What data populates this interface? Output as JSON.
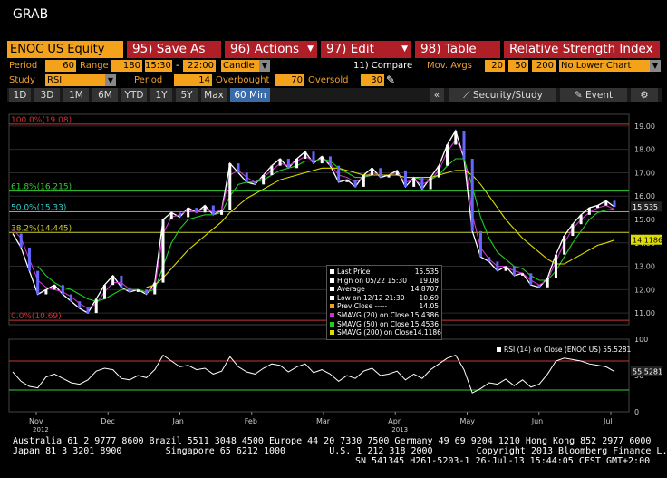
{
  "app_title": "GRAB",
  "ticker": "ENOC US Equity",
  "toolbar": [
    {
      "num": "95)",
      "label": "Save As"
    },
    {
      "num": "96)",
      "label": "Actions"
    },
    {
      "num": "97)",
      "label": "Edit"
    },
    {
      "num": "98)",
      "label": "Table"
    }
  ],
  "study_title": "Relative Strength Index",
  "row1": {
    "period_label": "Period",
    "period_value": "60",
    "range_label": "Range",
    "range_value": "180",
    "time_from": "15:30",
    "time_sep": "-",
    "time_to": "22:00",
    "chart_type": "Candle",
    "compare_label": "11) Compare",
    "mov_avgs_label": "Mov. Avgs",
    "ma1": "20",
    "ma2": "50",
    "ma3": "200",
    "lower_chart": "No Lower Chart"
  },
  "row2": {
    "study_label": "Study",
    "study_value": "RSI",
    "period_label": "Period",
    "period_value": "14",
    "overbought_label": "Overbought",
    "overbought_value": "70",
    "oversold_label": "Oversold",
    "oversold_value": "30"
  },
  "tabs": [
    "1D",
    "3D",
    "1M",
    "6M",
    "YTD",
    "1Y",
    "5Y",
    "Max",
    "60 Min"
  ],
  "active_tab": "60 Min",
  "right_tabs": {
    "collapse": "«",
    "security_study": "Security/Study",
    "event": "Event",
    "settings": "⚙"
  },
  "colors": {
    "orange": "#f4a21c",
    "red": "#b01e27",
    "price": "#ffffff",
    "sma20": "#cc33cc",
    "sma50": "#22cc22",
    "sma200": "#dddd00",
    "fib": "#8888ff"
  },
  "chart_data": [
    {
      "type": "line",
      "subtype": "candlestick",
      "title": "",
      "ylim": [
        10.5,
        19.5
      ],
      "y_ticks": [
        "19.00",
        "18.00",
        "17.00",
        "16.00",
        "15.00",
        "14.00",
        "13.00",
        "12.00",
        "11.00"
      ],
      "fib_levels": [
        {
          "label": "100.0%(19.08)",
          "value": 19.08,
          "color": "#cc3333"
        },
        {
          "label": "61.8%(16.215)",
          "value": 16.215,
          "color": "#33cc33"
        },
        {
          "label": "50.0%(15.33)",
          "value": 15.33,
          "color": "#33cccc"
        },
        {
          "label": "38.2%(14.445)",
          "value": 14.445,
          "color": "#cccc33"
        },
        {
          "label": "0.0%(10.69)",
          "value": 10.69,
          "color": "#cc3333"
        }
      ],
      "price_tags": [
        {
          "text": "15.535",
          "value": 15.535,
          "bg": "#222",
          "fg": "#fff"
        },
        {
          "text": "14.1186",
          "value": 14.1186,
          "bg": "#dddd00",
          "fg": "#000"
        }
      ],
      "x_labels": [
        "Nov",
        "Dec",
        "Jan",
        "Feb",
        "Mar",
        "Apr",
        "May",
        "Jun",
        "Jul"
      ],
      "x_sub_labels": [
        {
          "text": "2012",
          "at": "Nov"
        },
        {
          "text": "2013",
          "at": "Apr"
        }
      ],
      "legend": [
        {
          "label": "Last Price",
          "value": "15.535",
          "color": "#ffffff"
        },
        {
          "label": "High on 05/22 15:30",
          "value": "19.08",
          "color": "#ffffff"
        },
        {
          "label": "Average",
          "value": "14.8707",
          "color": "#ffffff"
        },
        {
          "label": "Low on 12/12 21:30",
          "value": "10.69",
          "color": "#ffffff"
        },
        {
          "label": "Prev Close -----",
          "value": "14.05",
          "color": "#f4a21c"
        },
        {
          "label": "SMAVG (20) on Close",
          "value": "15.4386",
          "color": "#cc33cc"
        },
        {
          "label": "SMAVG (50) on Close",
          "value": "15.4536",
          "color": "#22cc22"
        },
        {
          "label": "SMAVG (200) on Close",
          "value": "14.1186",
          "color": "#dddd00"
        }
      ],
      "series": [
        {
          "name": "Last Price",
          "values": [
            14.4,
            13.8,
            12.8,
            11.8,
            12.0,
            12.2,
            11.8,
            11.5,
            11.2,
            11.0,
            11.6,
            12.2,
            12.6,
            12.1,
            11.9,
            12.0,
            11.8,
            12.3,
            15.0,
            15.3,
            15.1,
            15.5,
            15.3,
            15.6,
            15.2,
            15.4,
            17.4,
            17.0,
            16.6,
            16.5,
            16.9,
            17.3,
            17.6,
            17.2,
            17.6,
            17.9,
            17.4,
            17.7,
            17.3,
            16.6,
            16.7,
            16.4,
            16.9,
            17.2,
            16.8,
            16.9,
            17.1,
            16.4,
            16.8,
            16.3,
            16.8,
            17.3,
            18.2,
            18.8,
            17.6,
            14.5,
            13.4,
            13.2,
            12.8,
            13.0,
            12.6,
            12.7,
            12.2,
            12.1,
            12.5,
            13.5,
            14.3,
            14.8,
            15.2,
            15.5,
            15.6,
            15.8,
            15.535
          ]
        },
        {
          "name": "SMAVG (20) on Close",
          "values": [
            14.6,
            14.2,
            13.3,
            12.4,
            12.1,
            12.0,
            11.9,
            11.7,
            11.4,
            11.2,
            11.4,
            11.9,
            12.3,
            12.3,
            12.0,
            12.0,
            11.9,
            12.1,
            14.4,
            15.1,
            15.2,
            15.4,
            15.3,
            15.5,
            15.3,
            15.4,
            16.9,
            17.1,
            16.8,
            16.6,
            16.8,
            17.1,
            17.4,
            17.3,
            17.5,
            17.7,
            17.5,
            17.6,
            17.4,
            16.9,
            16.8,
            16.6,
            16.8,
            17.0,
            16.9,
            16.9,
            17.0,
            16.6,
            16.7,
            16.5,
            16.7,
            17.1,
            17.9,
            18.4,
            17.8,
            15.2,
            13.8,
            13.3,
            13.0,
            13.0,
            12.8,
            12.7,
            12.4,
            12.2,
            12.4,
            13.2,
            14.0,
            14.6,
            15.0,
            15.3,
            15.5,
            15.6,
            15.4386
          ]
        },
        {
          "name": "SMAVG (50) on Close",
          "values": [
            null,
            null,
            null,
            13.0,
            12.6,
            12.3,
            12.1,
            12.0,
            11.8,
            11.6,
            11.5,
            11.6,
            11.8,
            12.0,
            12.0,
            12.0,
            11.9,
            12.0,
            13.0,
            14.0,
            14.6,
            15.0,
            15.1,
            15.2,
            15.2,
            15.3,
            16.0,
            16.5,
            16.6,
            16.6,
            16.7,
            16.9,
            17.1,
            17.2,
            17.3,
            17.5,
            17.5,
            17.6,
            17.5,
            17.2,
            17.0,
            16.8,
            16.8,
            16.9,
            16.9,
            16.9,
            16.9,
            16.8,
            16.8,
            16.7,
            16.7,
            16.9,
            17.3,
            17.6,
            17.6,
            16.4,
            15.1,
            14.2,
            13.6,
            13.3,
            13.0,
            12.9,
            12.6,
            12.4,
            12.4,
            12.8,
            13.4,
            14.0,
            14.5,
            15.0,
            15.3,
            15.4,
            15.4536
          ]
        },
        {
          "name": "SMAVG (200) on Close",
          "values": [
            null,
            null,
            null,
            null,
            null,
            null,
            null,
            null,
            null,
            null,
            null,
            null,
            null,
            null,
            null,
            null,
            12.1,
            12.2,
            12.5,
            12.9,
            13.3,
            13.7,
            14.0,
            14.3,
            14.6,
            14.9,
            15.3,
            15.6,
            15.9,
            16.1,
            16.3,
            16.5,
            16.7,
            16.8,
            16.9,
            17.0,
            17.1,
            17.2,
            17.2,
            17.2,
            17.1,
            17.0,
            16.9,
            16.9,
            16.9,
            16.9,
            16.9,
            16.8,
            16.8,
            16.8,
            16.8,
            16.9,
            17.0,
            17.1,
            17.1,
            16.9,
            16.5,
            16.0,
            15.5,
            15.0,
            14.6,
            14.2,
            13.9,
            13.6,
            13.3,
            13.1,
            13.1,
            13.3,
            13.5,
            13.7,
            13.9,
            14.0,
            14.1186
          ]
        }
      ]
    },
    {
      "type": "line",
      "title": "",
      "ylim": [
        0,
        100
      ],
      "y_ticks": [
        "100",
        "50",
        "0"
      ],
      "overbought": 70,
      "oversold": 30,
      "legend": [
        {
          "label": "RSI (14) on Close (ENOC US)",
          "value": "55.5281",
          "color": "#ffffff"
        }
      ],
      "price_tags": [
        {
          "text": "55.5281",
          "value": 55.5281,
          "bg": "#222",
          "fg": "#fff"
        }
      ],
      "series": [
        {
          "name": "RSI (14) on Close (ENOC US)",
          "values": [
            55,
            42,
            35,
            33,
            48,
            52,
            46,
            40,
            38,
            44,
            56,
            60,
            58,
            46,
            44,
            50,
            47,
            58,
            78,
            70,
            62,
            64,
            58,
            60,
            52,
            56,
            76,
            62,
            55,
            52,
            60,
            66,
            64,
            55,
            62,
            66,
            54,
            58,
            52,
            42,
            50,
            46,
            56,
            60,
            50,
            52,
            56,
            44,
            52,
            46,
            58,
            66,
            74,
            78,
            58,
            26,
            32,
            40,
            38,
            45,
            36,
            44,
            34,
            38,
            52,
            70,
            74,
            72,
            70,
            66,
            64,
            62,
            55.5281
          ]
        }
      ]
    }
  ],
  "footer": {
    "line1": "Australia 61 2 9777 8600 Brazil 5511 3048 4500 Europe 44 20 7330 7500 Germany 49 69 9204 1210 Hong Kong 852 2977 6000",
    "line2": "Japan 81 3 3201 8900        Singapore 65 6212 1000        U.S. 1 212 318 2000        Copyright 2013 Bloomberg Finance L.P.",
    "line3": "SN 541345 H261-5203-1 26-Jul-13 15:44:05 CEST GMT+2:00"
  }
}
